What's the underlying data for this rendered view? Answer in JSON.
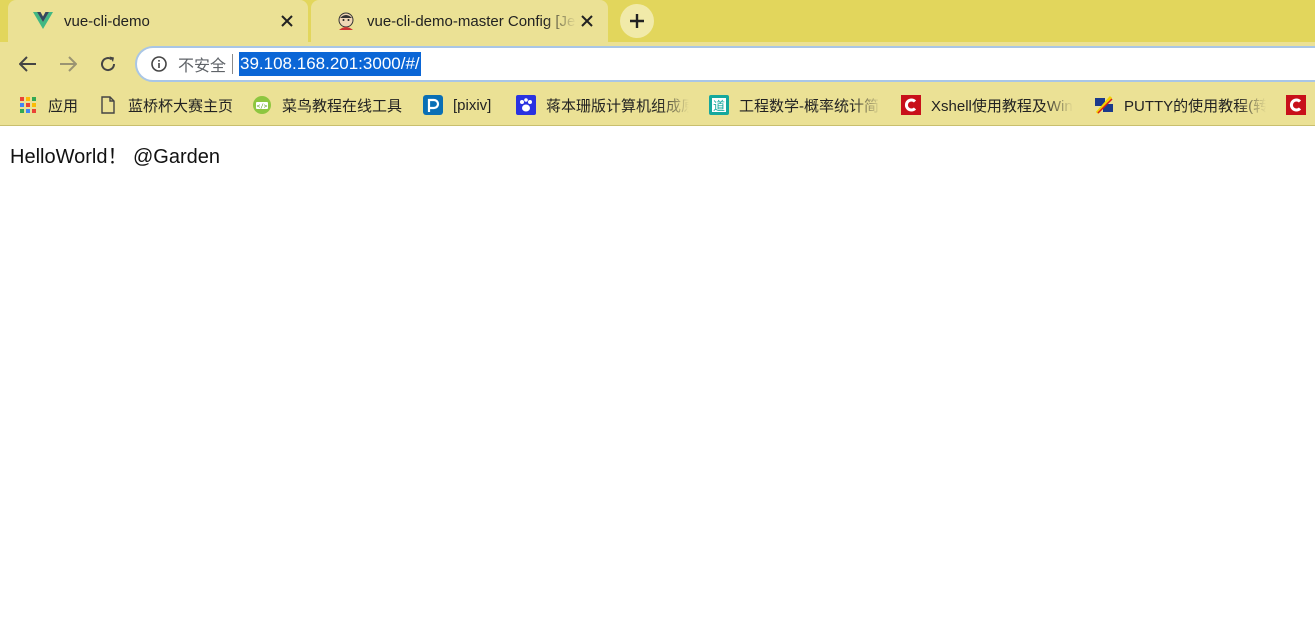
{
  "tabs": [
    {
      "title": "vue-cli-demo",
      "active": true,
      "favicon": "vue-logo-icon"
    },
    {
      "title": "vue-cli-demo-master Config [Jenkins]",
      "active": false,
      "favicon": "jenkins-icon"
    }
  ],
  "toolbar": {
    "security_label": "不安全",
    "url": "39.108.168.201:3000/#/"
  },
  "bookmarks": [
    {
      "label": "应用",
      "icon": "apps-grid-icon"
    },
    {
      "label": "蓝桥杯大赛主页",
      "icon": "document-icon"
    },
    {
      "label": "菜鸟教程在线工具",
      "icon": "runoob-icon"
    },
    {
      "label": "[pixiv]",
      "icon": "pixiv-icon"
    },
    {
      "label": "蒋本珊版计算机组成原",
      "icon": "baidu-paw-icon"
    },
    {
      "label": "工程数学-概率统计简",
      "icon": "doc88-icon"
    },
    {
      "label": "Xshell使用教程及Win",
      "icon": "csdn-icon"
    },
    {
      "label": "PUTTY的使用教程(转",
      "icon": "putty-icon"
    }
  ],
  "page": {
    "text": "HelloWorld！ @Garden"
  },
  "colors": {
    "tabstrip": "#e2d65c",
    "toolbar": "#ebe195",
    "url_highlight": "#0b66d6",
    "csdn_red": "#c8101a"
  }
}
